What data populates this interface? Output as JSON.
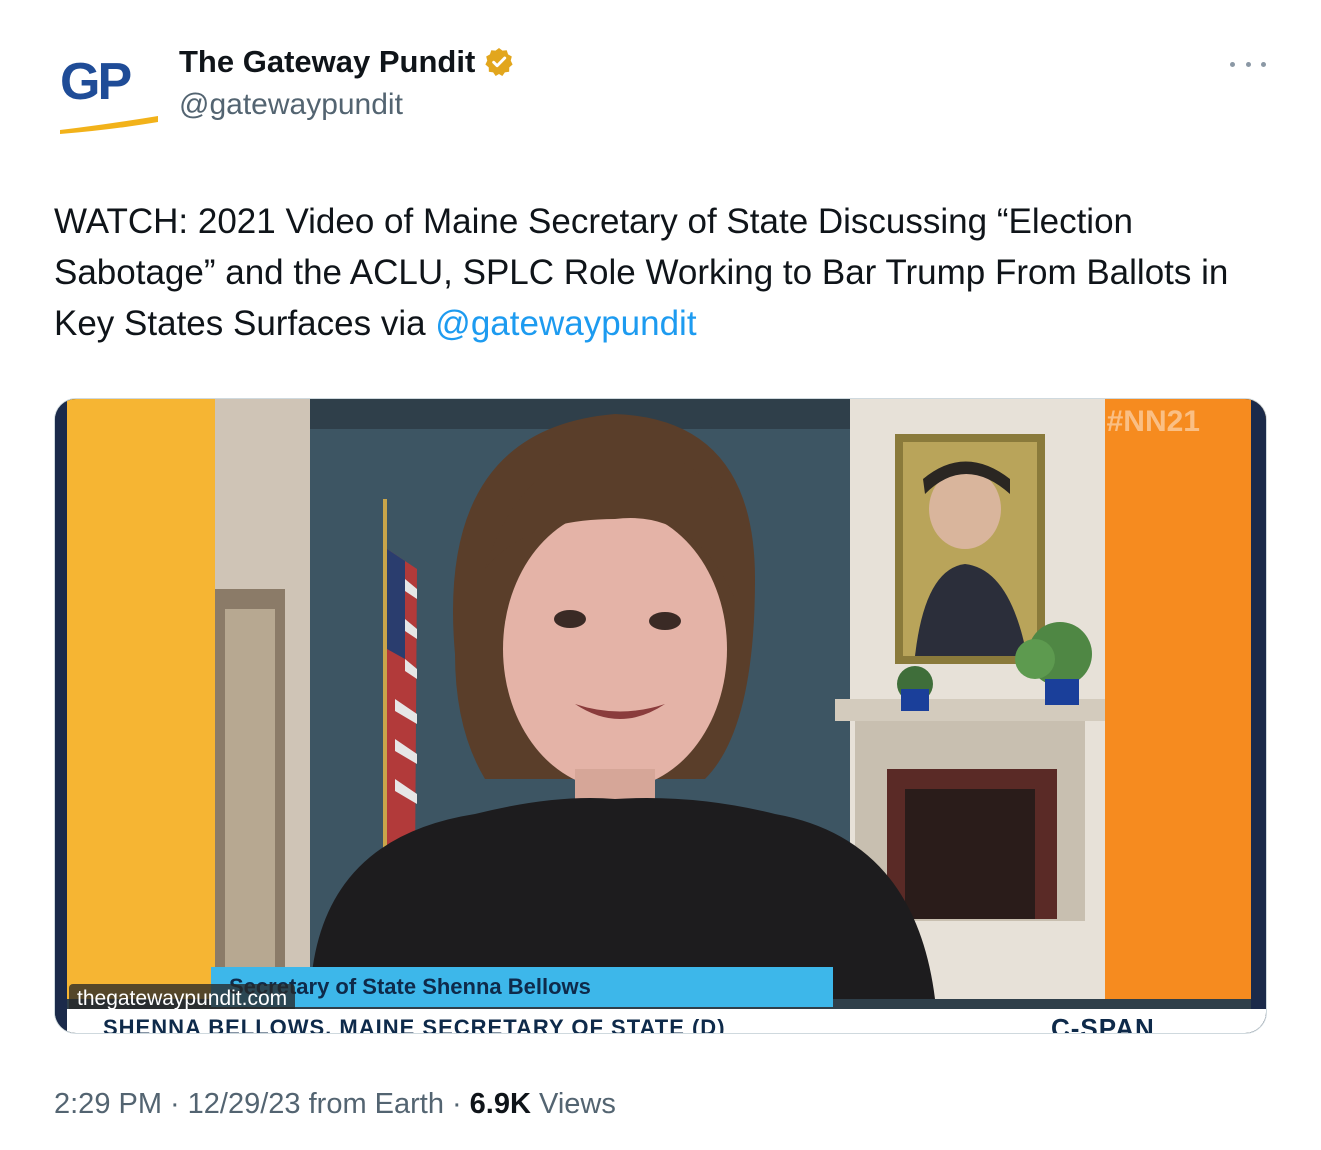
{
  "author": {
    "avatar_text": "GP",
    "name": "The Gateway Pundit",
    "handle": "@gatewaypundit",
    "verified_icon": "gold-verified-badge-icon",
    "brand_color": "#1f4c97",
    "accent_color": "#f2b21a"
  },
  "tweet": {
    "text": "WATCH: 2021 Video of Maine Secretary of State Discussing “Election Sabotage” and the ACLU, SPLC Role Working to Bar Trump From Ballots in Key States Surfaces via ",
    "mention": "@gatewaypundit",
    "mention_color": "#1d9bf0"
  },
  "media": {
    "hashtag": "#NN21",
    "lower_third": "Secretary of State Shenna Bellows",
    "watermark": "thegatewaypundit.com",
    "chyron": "SHENNA BELLOWS, MAINE SECRETARY OF STATE (D)",
    "network": "C-SPAN"
  },
  "meta": {
    "time": "2:29 PM",
    "separator": "·",
    "date_source": "12/29/23 from Earth",
    "views_count": "6.9K",
    "views_label": "Views"
  }
}
